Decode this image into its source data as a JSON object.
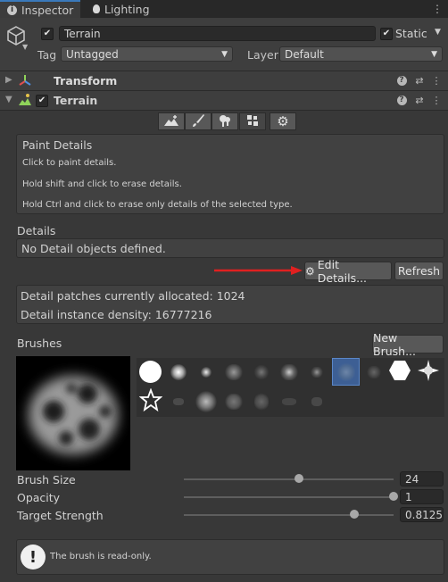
{
  "tabs": [
    {
      "label": "Inspector"
    },
    {
      "label": "Lighting"
    }
  ],
  "gameobject": {
    "name": "Terrain",
    "static_label": "Static",
    "tag_label": "Tag",
    "tag_value": "Untagged",
    "layer_label": "Layer",
    "layer_value": "Default"
  },
  "components": {
    "transform": "Transform",
    "terrain": "Terrain"
  },
  "toolbar": {
    "tools": [
      "raise-terrain",
      "paint-texture",
      "paint-trees",
      "paint-details",
      "terrain-settings"
    ],
    "selected": "paint-details"
  },
  "paint_details": {
    "title": "Paint Details",
    "line1": "Click to paint details.",
    "line2": "Hold shift and click to erase details.",
    "line3": "Hold Ctrl and click to erase only details of the selected type."
  },
  "details": {
    "header": "Details",
    "empty": "No Detail objects defined.",
    "edit_button": "Edit Details...",
    "refresh_button": "Refresh",
    "patches": "Detail patches currently allocated: 1024",
    "density": "Detail instance density: 16777216"
  },
  "brushes": {
    "header": "Brushes",
    "new_button": "New Brush...",
    "selected_index": 7
  },
  "settings": {
    "size_label": "Brush Size",
    "size_value": "24",
    "size_fraction": 0.55,
    "opacity_label": "Opacity",
    "opacity_value": "1",
    "opacity_fraction": 1.0,
    "strength_label": "Target Strength",
    "strength_value": "0.8125",
    "strength_fraction": 0.8125
  },
  "warning": {
    "text": "The brush is read-only."
  },
  "colors": {
    "accent": "#3a79bb",
    "arrow": "#e02020",
    "component_title_blue": "#7fb0e8"
  }
}
